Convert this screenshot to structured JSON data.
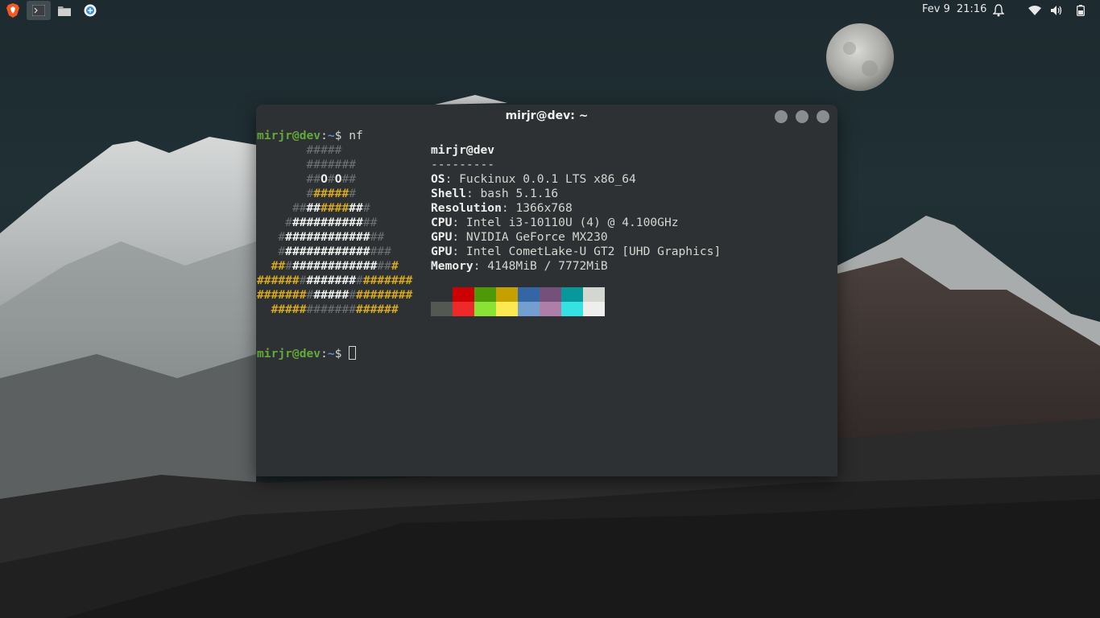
{
  "panel": {
    "date": "Fev 9",
    "time": "21:16",
    "apps": [
      {
        "name": "brave-browser",
        "icon": "brave-icon",
        "active": false
      },
      {
        "name": "terminal",
        "icon": "terminal-icon",
        "active": true
      },
      {
        "name": "files",
        "icon": "folder-icon",
        "active": false
      },
      {
        "name": "web",
        "icon": "globe-icon",
        "active": false
      }
    ],
    "tray_icons": [
      "bell-icon",
      "wifi-icon",
      "volume-icon",
      "battery-icon"
    ]
  },
  "window": {
    "title": "mirjr@dev: ~"
  },
  "terminal": {
    "prompt_user": "mirjr@dev",
    "prompt_sep": ":",
    "prompt_path": "~",
    "prompt_symbol": "$",
    "command": "nf",
    "logo": [
      "       #####",
      "       #######",
      "       ##O#O##",
      "       #######",
      "     ###########",
      "    #############",
      "   ###############",
      "   ################",
      "  ##################",
      "######################",
      "######################",
      "  ##################"
    ],
    "header": "mirjr@dev",
    "separator": "---------",
    "info": [
      {
        "key": "OS",
        "value": "Fuckinux 0.0.1 LTS x86_64"
      },
      {
        "key": "Shell",
        "value": "bash 5.1.16"
      },
      {
        "key": "Resolution",
        "value": "1366x768"
      },
      {
        "key": "CPU",
        "value": "Intel i3-10110U (4) @ 4.100GHz"
      },
      {
        "key": "GPU",
        "value": "NVIDIA GeForce MX230"
      },
      {
        "key": "GPU",
        "value": "Intel CometLake-U GT2 [UHD Graphics]"
      },
      {
        "key": "Memory",
        "value": "4148MiB / 7772MiB"
      }
    ],
    "palette_top": [
      "#2d3134",
      "#cc0000",
      "#4e9a06",
      "#c4a000",
      "#3465a4",
      "#75507b",
      "#06989a",
      "#d3d7cf"
    ],
    "palette_bottom": [
      "#555753",
      "#ef2929",
      "#8ae234",
      "#fce94f",
      "#729fcf",
      "#ad7fa8",
      "#34e2e2",
      "#eeeeec"
    ]
  }
}
